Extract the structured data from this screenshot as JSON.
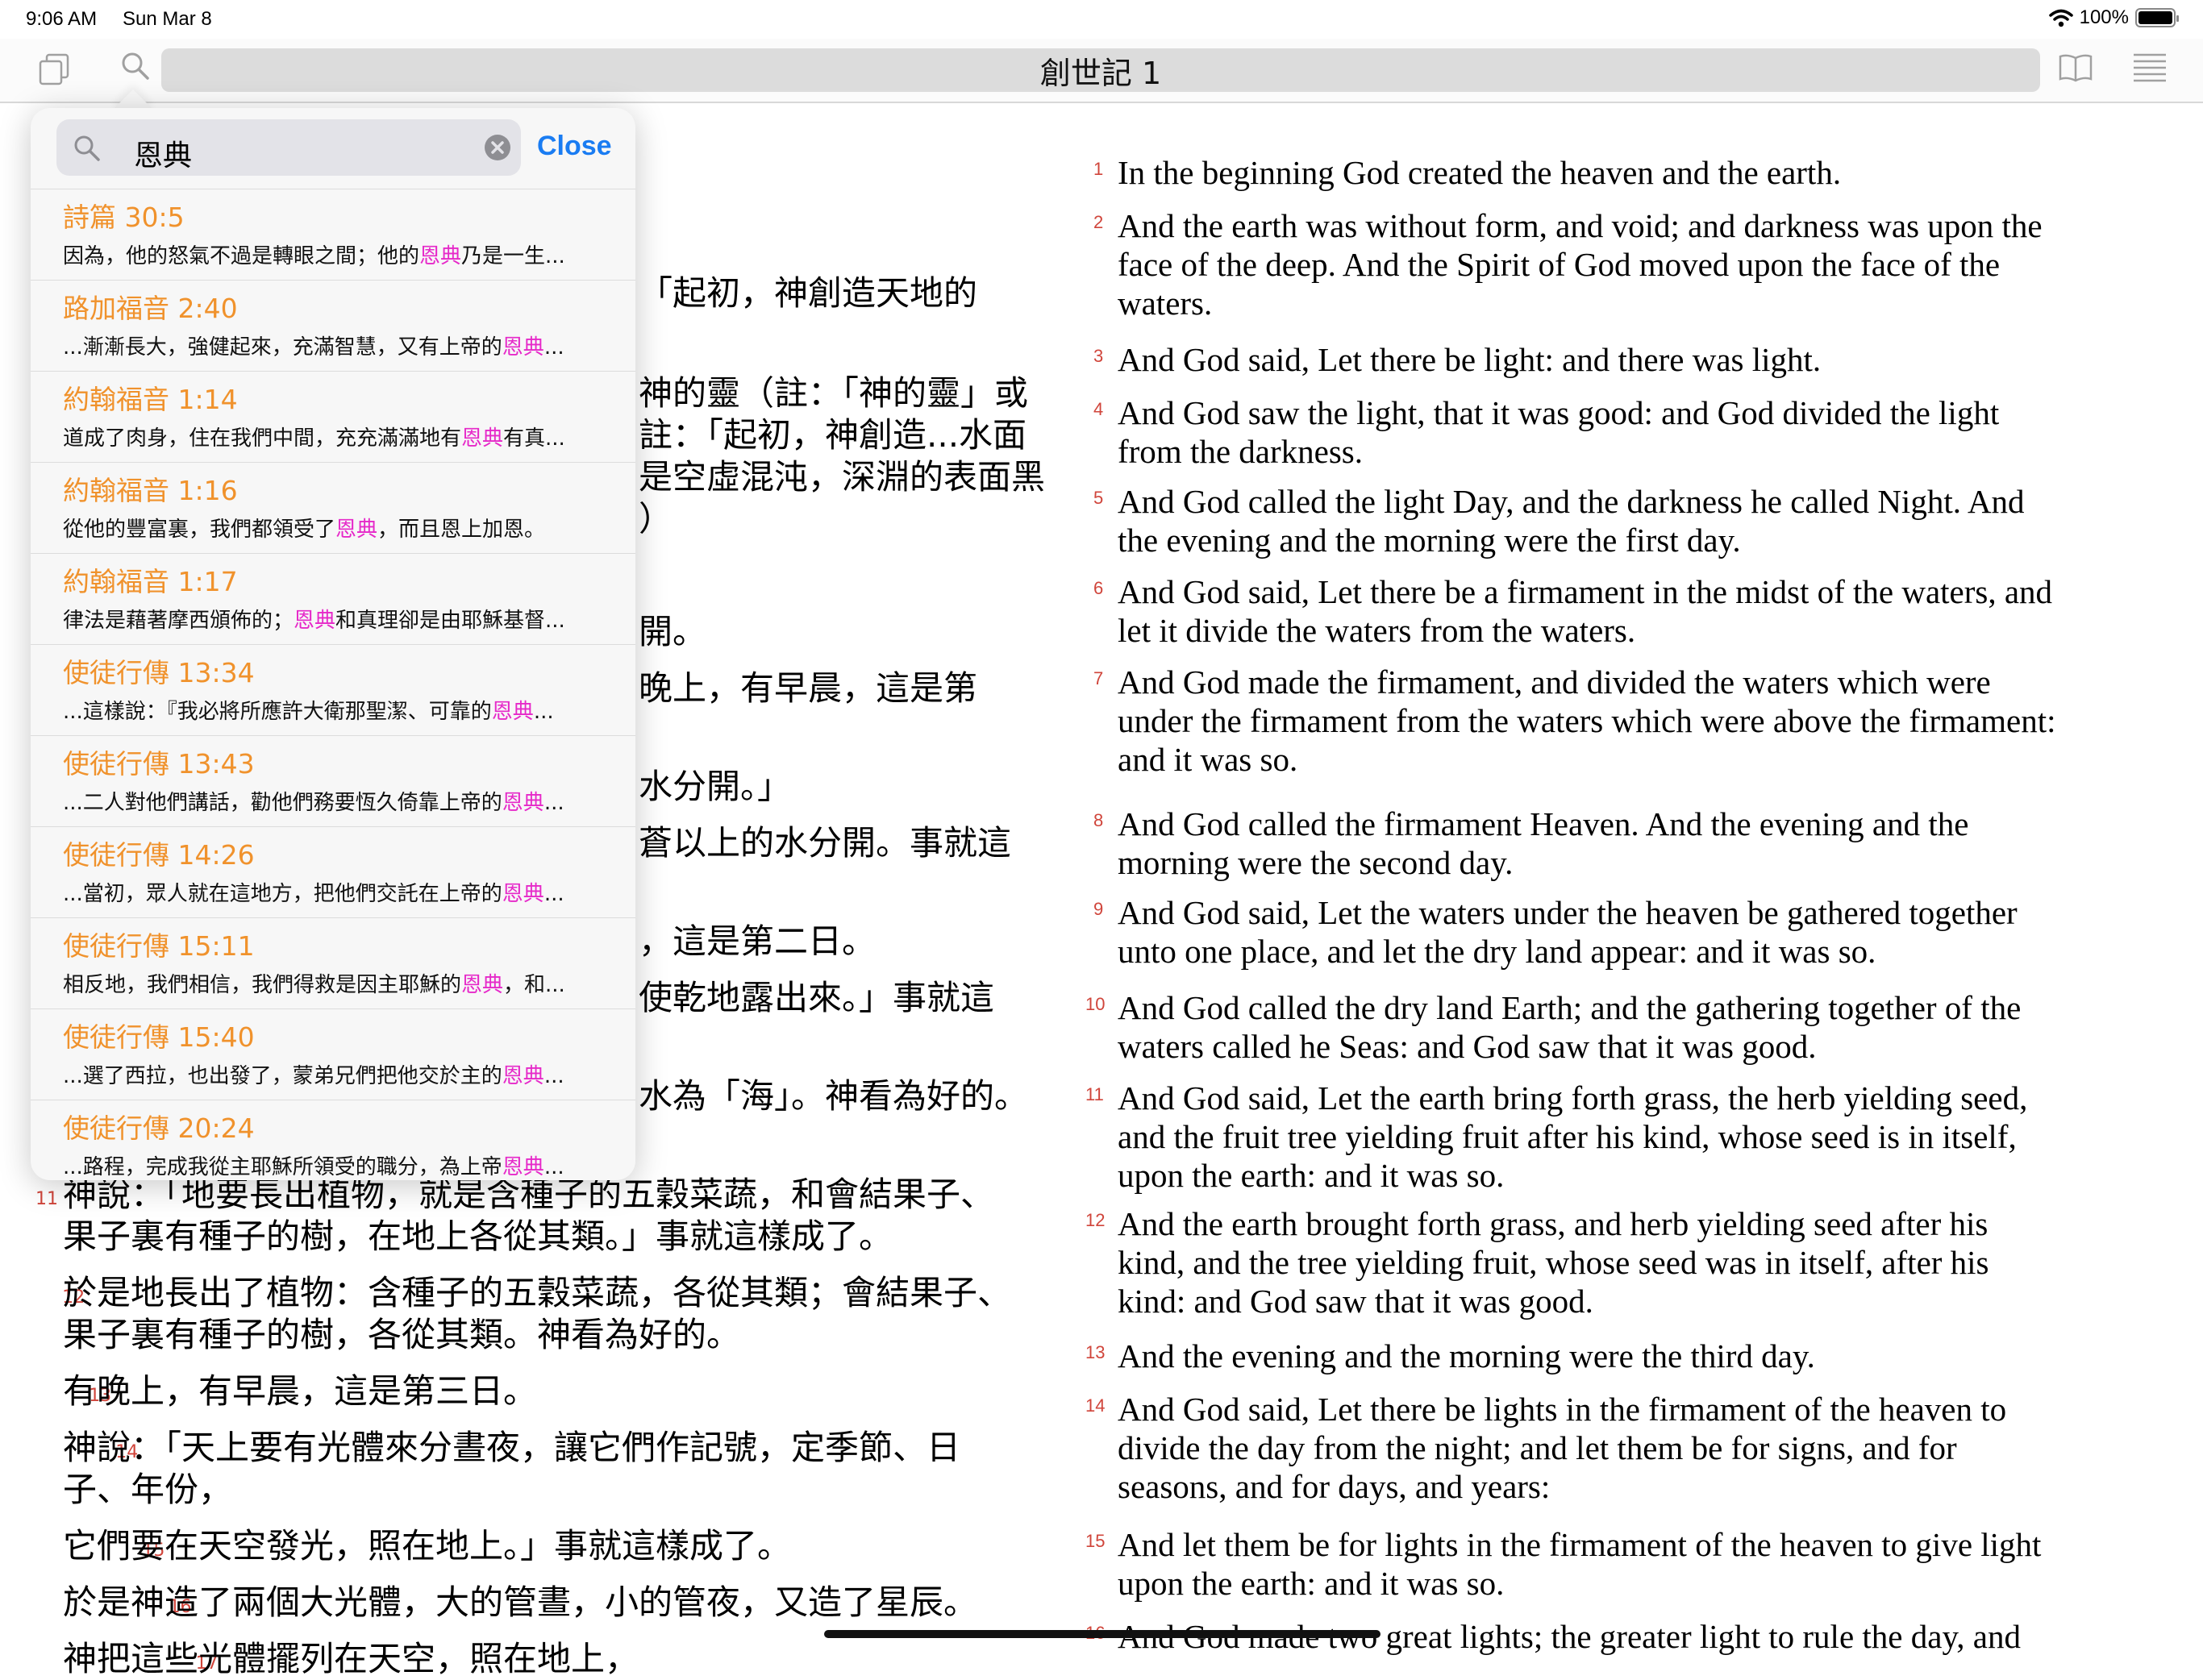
{
  "status_bar": {
    "time": "9:06 AM",
    "date": "Sun Mar 8",
    "battery": "100%",
    "battery_level": 1.0
  },
  "toolbar": {
    "title": "創世記 1",
    "icons": [
      "copy-icon",
      "search-icon",
      "book-icon",
      "list-icon"
    ]
  },
  "search": {
    "query": "恩典",
    "close_label": "Close"
  },
  "results": [
    {
      "ref": "詩篇 30:5",
      "pre": "因為，他的怒氣不過是轉眼之間；他的",
      "hit": "恩典",
      "post": "乃是一生..."
    },
    {
      "ref": "路加福音 2:40",
      "pre": "...漸漸長大，強健起來，充滿智慧，又有上帝的",
      "hit": "恩典",
      "post": "..."
    },
    {
      "ref": "約翰福音 1:14",
      "pre": "道成了肉身，住在我們中間，充充滿滿地有",
      "hit": "恩典",
      "post": "有真..."
    },
    {
      "ref": "約翰福音 1:16",
      "pre": "從他的豐富裏，我們都領受了",
      "hit": "恩典",
      "post": "，而且恩上加恩。"
    },
    {
      "ref": "約翰福音 1:17",
      "pre": "律法是藉著摩西頒佈的；",
      "hit": "恩典",
      "post": "和真理卻是由耶穌基督..."
    },
    {
      "ref": "使徒行傳 13:34",
      "pre": "...這樣說：『我必將所應許大衛那聖潔、可靠的",
      "hit": "恩典",
      "post": "..."
    },
    {
      "ref": "使徒行傳 13:43",
      "pre": "...二人對他們講話，勸他們務要恆久倚靠上帝的",
      "hit": "恩典",
      "post": "..."
    },
    {
      "ref": "使徒行傳 14:26",
      "pre": "...當初，眾人就在這地方，把他們交託在上帝的",
      "hit": "恩典",
      "post": "..."
    },
    {
      "ref": "使徒行傳 15:11",
      "pre": "相反地，我們相信，我們得救是因主耶穌的",
      "hit": "恩典",
      "post": "，和..."
    },
    {
      "ref": "使徒行傳 15:40",
      "pre": "...選了西拉，也出發了，蒙弟兄們把他交於主的",
      "hit": "恩典",
      "post": "..."
    },
    {
      "ref": "使徒行傳 20:24",
      "pre": "...路程，完成我從主耶穌所領受的職分，為上帝",
      "hit": "恩典",
      "post": "..."
    }
  ],
  "chinese_visible": {
    "l1": "「起初，神創造天地的",
    "l2": "神的靈（註：「神的靈」或",
    "l3": "註：「起初，神創造...水面",
    "l4": "是空虛混沌，深淵的表面黑",
    "l5": "）",
    "l6": "開。",
    "l7": "晚上，有早晨，這是第",
    "l8": "水分開。」",
    "l9": "蒼以上的水分開。事就這",
    "l10": "，這是第二日。",
    "l11": "使乾地露出來。」事就這",
    "l12": "水為「海」。神看為好的。",
    "v11_num": "11",
    "v11a": "神說：「地要長出植物，就是含種子的五穀菜蔬，和會結果子、",
    "v11b": "果子裏有種子的樹，在地上各從其類。」事就這樣成了。",
    "v12_num": "12",
    "v12a": "於是地長出了植物：含種子的五穀菜蔬，各從其類；會結果子、",
    "v12b": "果子裏有種子的樹，各從其類。神看為好的。",
    "v13_num": "13",
    "v13": "有晚上，有早晨，這是第三日。",
    "v14_num": "14",
    "v14a": "神說：「天上要有光體來分晝夜，讓它們作記號，定季節、日",
    "v14b": "子、年份，",
    "v15_num": "15",
    "v15": "它們要在天空發光，照在地上。」事就這樣成了。",
    "v16_num": "16",
    "v16": "於是神造了兩個大光體，大的管晝，小的管夜，又造了星辰。",
    "v17_num": "17",
    "v17": "神把這些光體擺列在天空，照在地上，"
  },
  "english": [
    {
      "n": "1",
      "lines": [
        "In the beginning God created the heaven and the earth."
      ]
    },
    {
      "n": "2",
      "lines": [
        "And the earth was without form, and void; and darkness was upon the",
        "face of the deep. And the Spirit of God moved upon the face of the",
        "waters."
      ]
    },
    {
      "n": "3",
      "lines": [
        "And God said, Let there be light: and there was light."
      ]
    },
    {
      "n": "4",
      "lines": [
        "And God saw the light, that it was good: and God divided the light",
        "from the darkness."
      ]
    },
    {
      "n": "5",
      "lines": [
        "And God called the light Day, and the darkness he called Night. And",
        "the evening and the morning were the first day."
      ]
    },
    {
      "n": "6",
      "lines": [
        "And God said, Let there be a firmament in the midst of the waters, and",
        "let it divide the waters from the waters."
      ]
    },
    {
      "n": "7",
      "lines": [
        "And God made the firmament, and divided the waters which were",
        "under the firmament from the waters which were above the firmament:",
        "and it was so."
      ]
    },
    {
      "n": "8",
      "lines": [
        "And God called the firmament Heaven. And the evening and the",
        "morning were the second day."
      ]
    },
    {
      "n": "9",
      "lines": [
        "And God said, Let the waters under the heaven be gathered together",
        "unto one place, and let the dry land appear: and it was so."
      ]
    },
    {
      "n": "10",
      "lines": [
        "And God called the dry land Earth; and the gathering together of the",
        "waters called he Seas: and God saw that it was good."
      ]
    },
    {
      "n": "11",
      "lines": [
        "And God said, Let the earth bring forth grass, the herb yielding seed,",
        "and the fruit tree yielding fruit after his kind, whose seed is in itself,",
        "upon the earth: and it was so."
      ]
    },
    {
      "n": "12",
      "lines": [
        "And the earth brought forth grass, and herb yielding seed after his",
        "kind, and the tree yielding fruit, whose seed was in itself, after his",
        "kind: and God saw that it was good."
      ]
    },
    {
      "n": "13",
      "lines": [
        "And the evening and the morning were the third day."
      ]
    },
    {
      "n": "14",
      "lines": [
        "And God said, Let there be lights in the firmament of the heaven to",
        "divide the day from the night; and let them be for signs, and for",
        "seasons, and for days, and years:"
      ]
    },
    {
      "n": "15",
      "lines": [
        "And let them be for lights in the firmament of the heaven to give light",
        "upon the earth: and it was so."
      ]
    },
    {
      "n": "16",
      "lines": [
        "And God made two great lights; the greater light to rule the day, and"
      ]
    }
  ],
  "colors": {
    "verse_number": "#d0453b",
    "result_ref": "#f0922c",
    "highlight": "#e629c9",
    "link": "#1a7cf2"
  }
}
